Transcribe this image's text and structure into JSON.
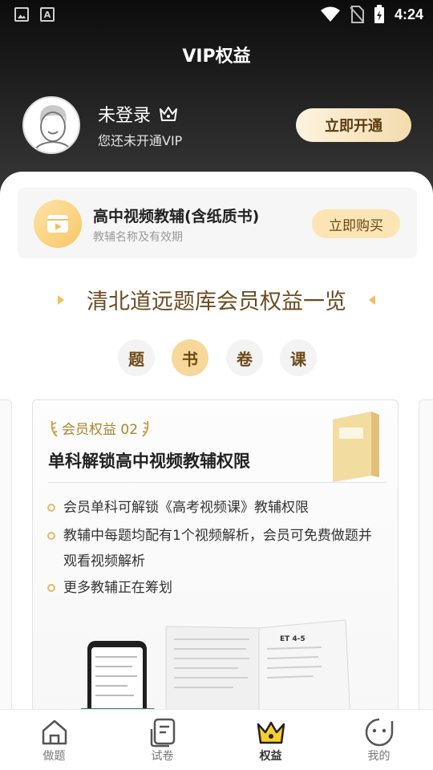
{
  "status_bar": {
    "time": "4:24"
  },
  "header": {
    "title": "VIP权益"
  },
  "user": {
    "name": "未登录",
    "subtitle": "您还未开通VIP",
    "open_button": "立即开通"
  },
  "promo": {
    "title": "高中视频教辅(含纸质书)",
    "subtitle": "教辅名称及有效期",
    "buy_button": "立即购买"
  },
  "section": {
    "title": "清北道远题库会员权益一览"
  },
  "tabs": [
    {
      "label": "题",
      "active": false
    },
    {
      "label": "书",
      "active": true
    },
    {
      "label": "卷",
      "active": false
    },
    {
      "label": "课",
      "active": false
    }
  ],
  "card": {
    "badge": "会员权益 02",
    "title": "单科解锁高中视频教辅权限",
    "bullets": [
      "会员单科可解锁《高考视频课》教辅权限",
      "教辅中每题均配有1个视频解析，会员可免费做题并观看视频解析",
      "更多教辅正在筹划"
    ],
    "book_cover_text": "ET 4-5"
  },
  "bottom_nav": [
    {
      "label": "做题",
      "icon": "home-icon",
      "active": false
    },
    {
      "label": "试卷",
      "icon": "paper-icon",
      "active": false
    },
    {
      "label": "权益",
      "icon": "crown-icon",
      "active": true
    },
    {
      "label": "我的",
      "icon": "face-icon",
      "active": false
    }
  ],
  "colors": {
    "accent_gold": "#f1c15e",
    "brown_text": "#6a4c22",
    "active_tab": "#f8d79a"
  }
}
